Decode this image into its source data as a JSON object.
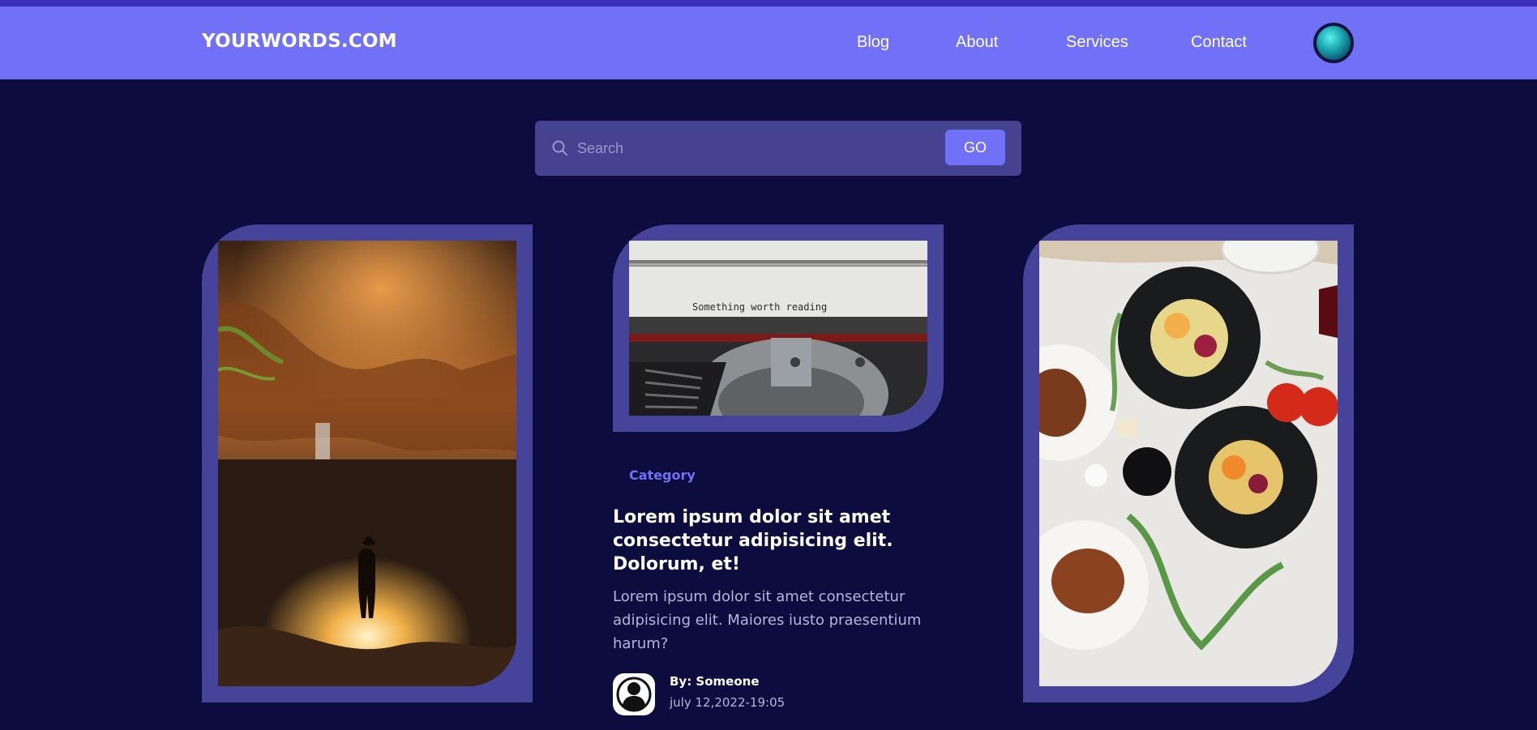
{
  "header": {
    "logo": "YOURWORDS.COM",
    "nav": [
      {
        "label": "Blog"
      },
      {
        "label": "About"
      },
      {
        "label": "Services"
      },
      {
        "label": "Contact"
      }
    ]
  },
  "search": {
    "placeholder": "Search",
    "button_label": "GO"
  },
  "cards": {
    "left_image": "cave-waterfall-photo",
    "middle_image": "typewriter-photo",
    "middle_image_text": "Something worth reading",
    "right_image": "food-platter-photo"
  },
  "post": {
    "category": "Category",
    "title": "Lorem ipsum dolor sit amet consectetur adipisicing elit. Dolorum, et!",
    "excerpt": "Lorem ipsum dolor sit amet consectetur adipisicing elit. Maiores iusto praesentium harum?",
    "author": "By: Someone",
    "date": "july 12,2022-19:05"
  },
  "colors": {
    "background": "#0d0c3f",
    "header": "#7171f8",
    "accent": "#7171f8",
    "card_frame": "#45439a"
  }
}
